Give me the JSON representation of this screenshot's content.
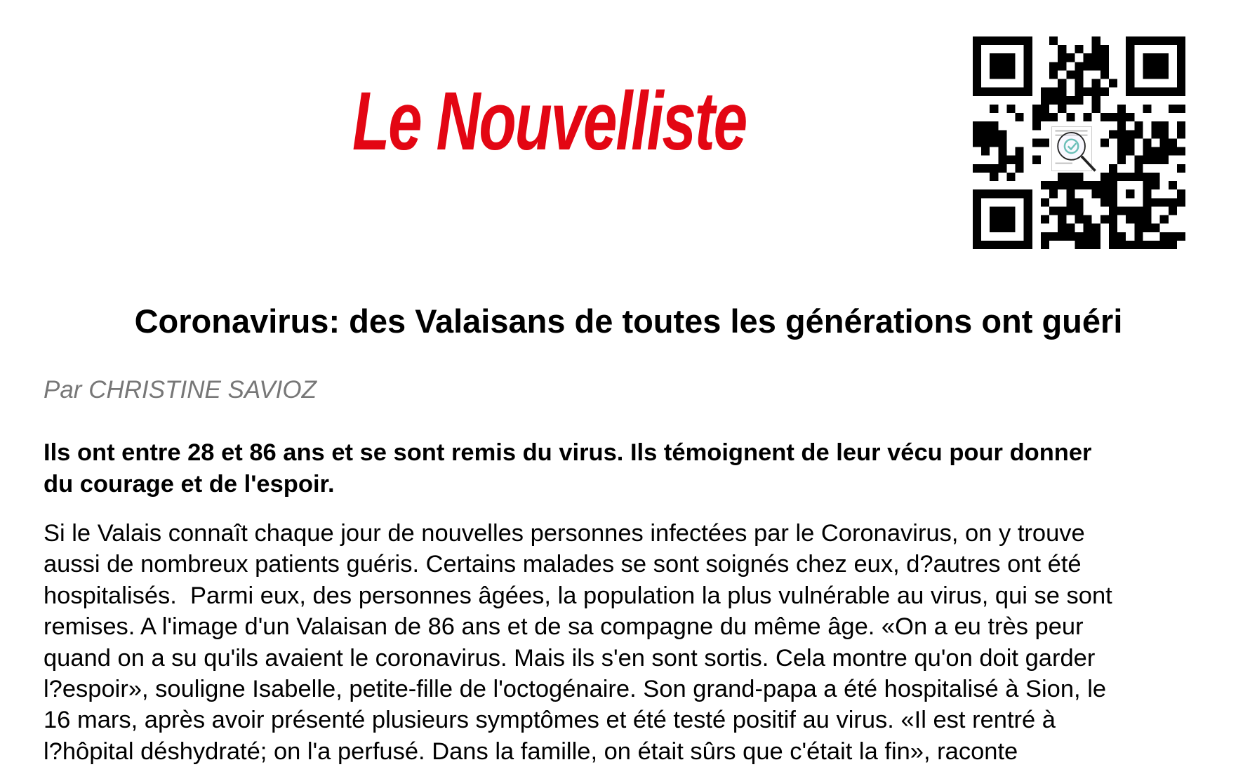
{
  "header": {
    "logo_text": "Le Nouvelliste",
    "brand_color": "#e30613",
    "qr_icon": "qr-code-with-magnifier-check-icon"
  },
  "article": {
    "title": "Coronavirus: des Valaisans de toutes les générations ont guéri",
    "byline": "Par CHRISTINE SAVIOZ",
    "lead_lines": [
      "Ils ont entre 28 et 86 ans et se sont remis du virus. Ils témoignent de leur vécu pour donner",
      "du courage et de l'espoir."
    ],
    "body_lines": [
      "Si le Valais connaît chaque jour de nouvelles personnes infectées par le Coronavirus, on y trouve",
      "aussi de nombreux patients guéris. Certains malades se sont soignés chez eux, d?autres ont été",
      "hospitalisés.  Parmi eux, des personnes âgées, la population la plus vulnérable au virus, qui se sont",
      "remises. A l'image d'un Valaisan de 86 ans et de sa compagne du même âge. «On a eu très peur",
      "quand on a su qu'ils avaient le coronavirus. Mais ils s'en sont sortis. Cela montre qu'on doit garder",
      "l?espoir», souligne Isabelle, petite-fille de l'octogénaire. Son grand-papa a été hospitalisé à Sion, le",
      "16 mars, après avoir présenté plusieurs symptômes et été testé positif au virus. «Il est rentré à",
      "l?hôpital déshydraté; on l'a perfusé. Dans la famille, on était sûrs que c'était la fin», raconte"
    ]
  }
}
